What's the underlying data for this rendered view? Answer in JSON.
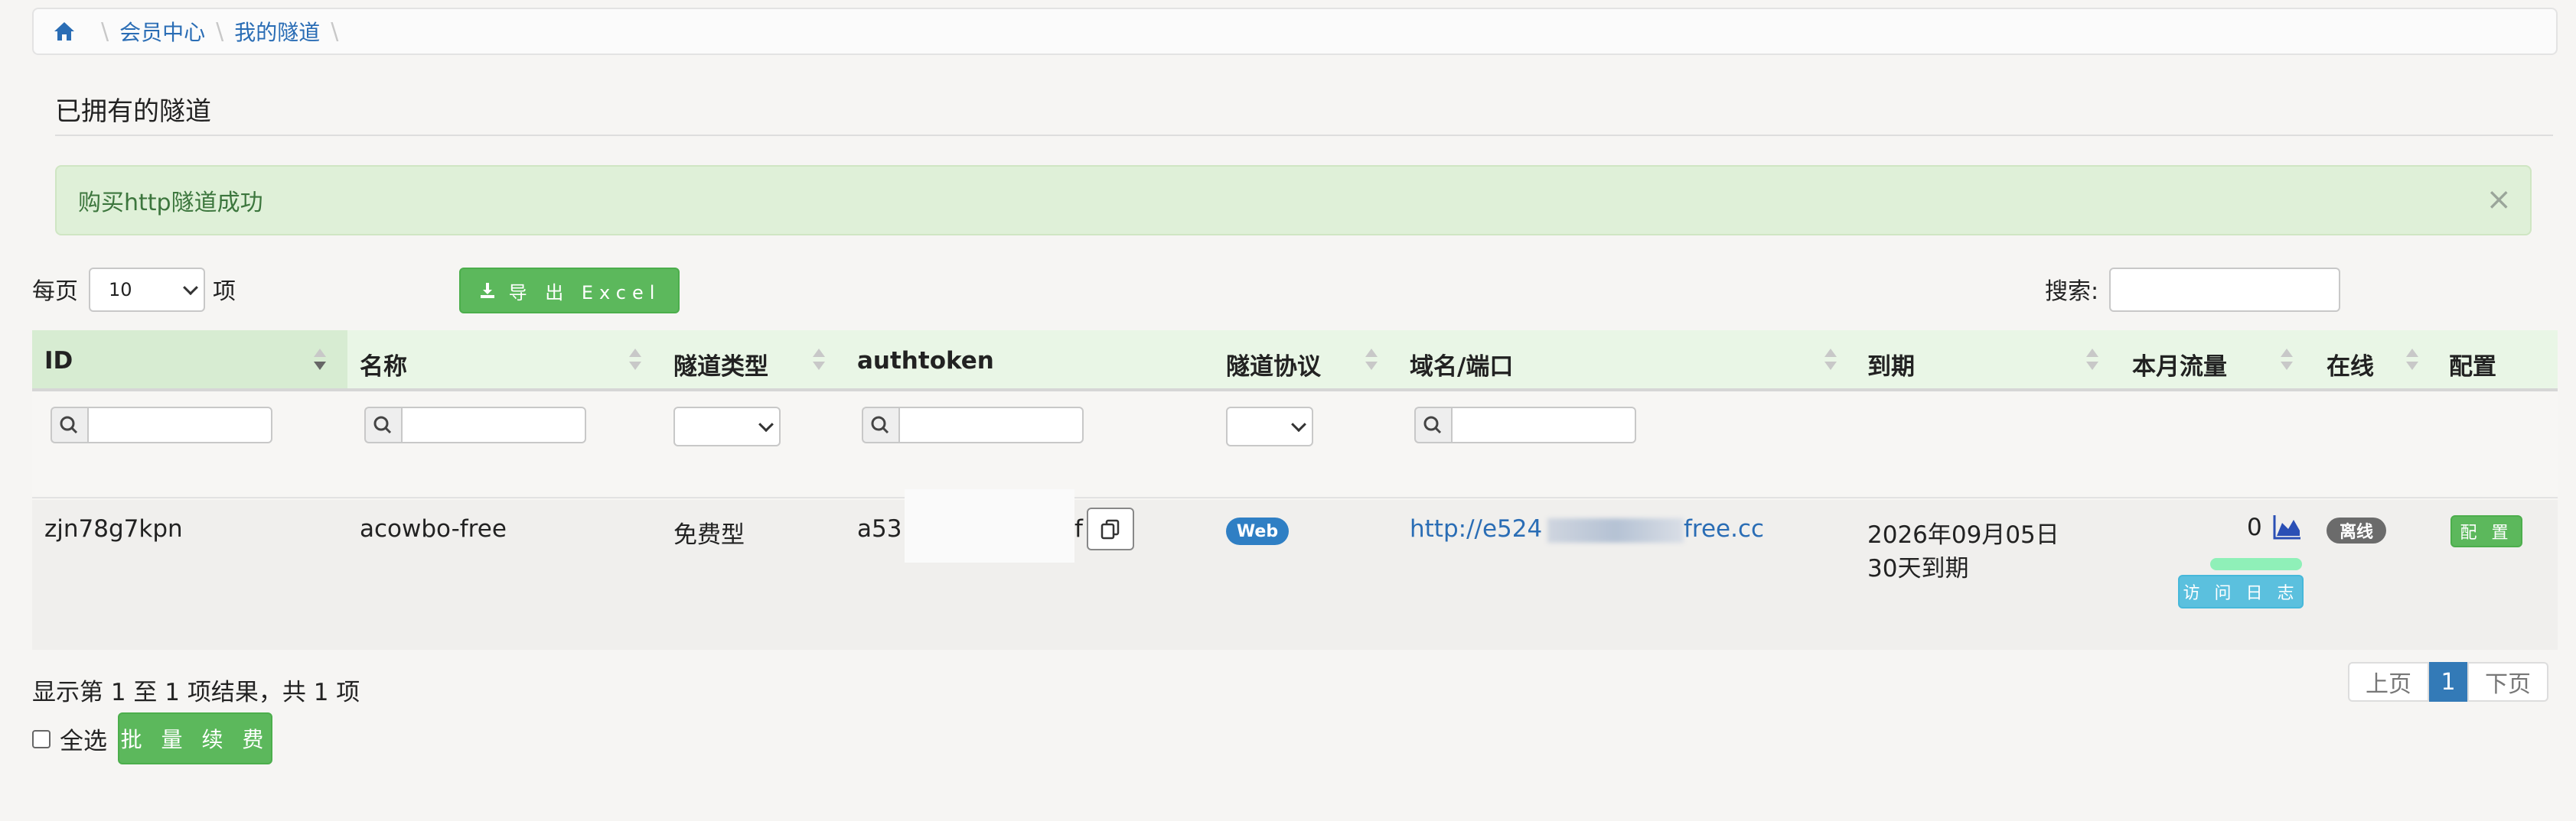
{
  "breadcrumb": {
    "items": [
      "会员中心",
      "我的隧道"
    ]
  },
  "section": {
    "title": "已拥有的隧道"
  },
  "alert": {
    "message": "购买http隧道成功",
    "close": "×"
  },
  "toolbar": {
    "per_page_prefix": "每页",
    "per_page_value": "10",
    "per_page_suffix": "项",
    "export_label": "导 出 Excel",
    "search_label": "搜索:",
    "search_value": ""
  },
  "table": {
    "columns": [
      "ID",
      "名称",
      "隧道类型",
      "authtoken",
      "隧道协议",
      "域名/端口",
      "到期",
      "本月流量",
      "在线",
      "配置"
    ],
    "rows": [
      {
        "id": "zjn78g7kpn",
        "name": "acowbo-free",
        "type": "免费型",
        "authtoken_start": "a53",
        "authtoken_end": "f",
        "protocol": "Web",
        "domain_start": "http://e524",
        "domain_end": "free.cc",
        "expire_date": "2026年09月05日",
        "expire_note": "30天到期",
        "traffic": "0",
        "log_button": "访 问 日 志",
        "online": "离线",
        "config_button": "配 置"
      }
    ]
  },
  "footer": {
    "info": "显示第 1 至 1 项结果，共 1 项",
    "select_all": "全选",
    "renew_button": "批 量 续 费",
    "pager": {
      "prev": "上页",
      "current": "1",
      "next": "下页"
    }
  },
  "colors": {
    "accent": "#5cb85c",
    "link": "#2a6db5",
    "info": "#5bc0de",
    "alert_bg": "#dff0d8"
  }
}
